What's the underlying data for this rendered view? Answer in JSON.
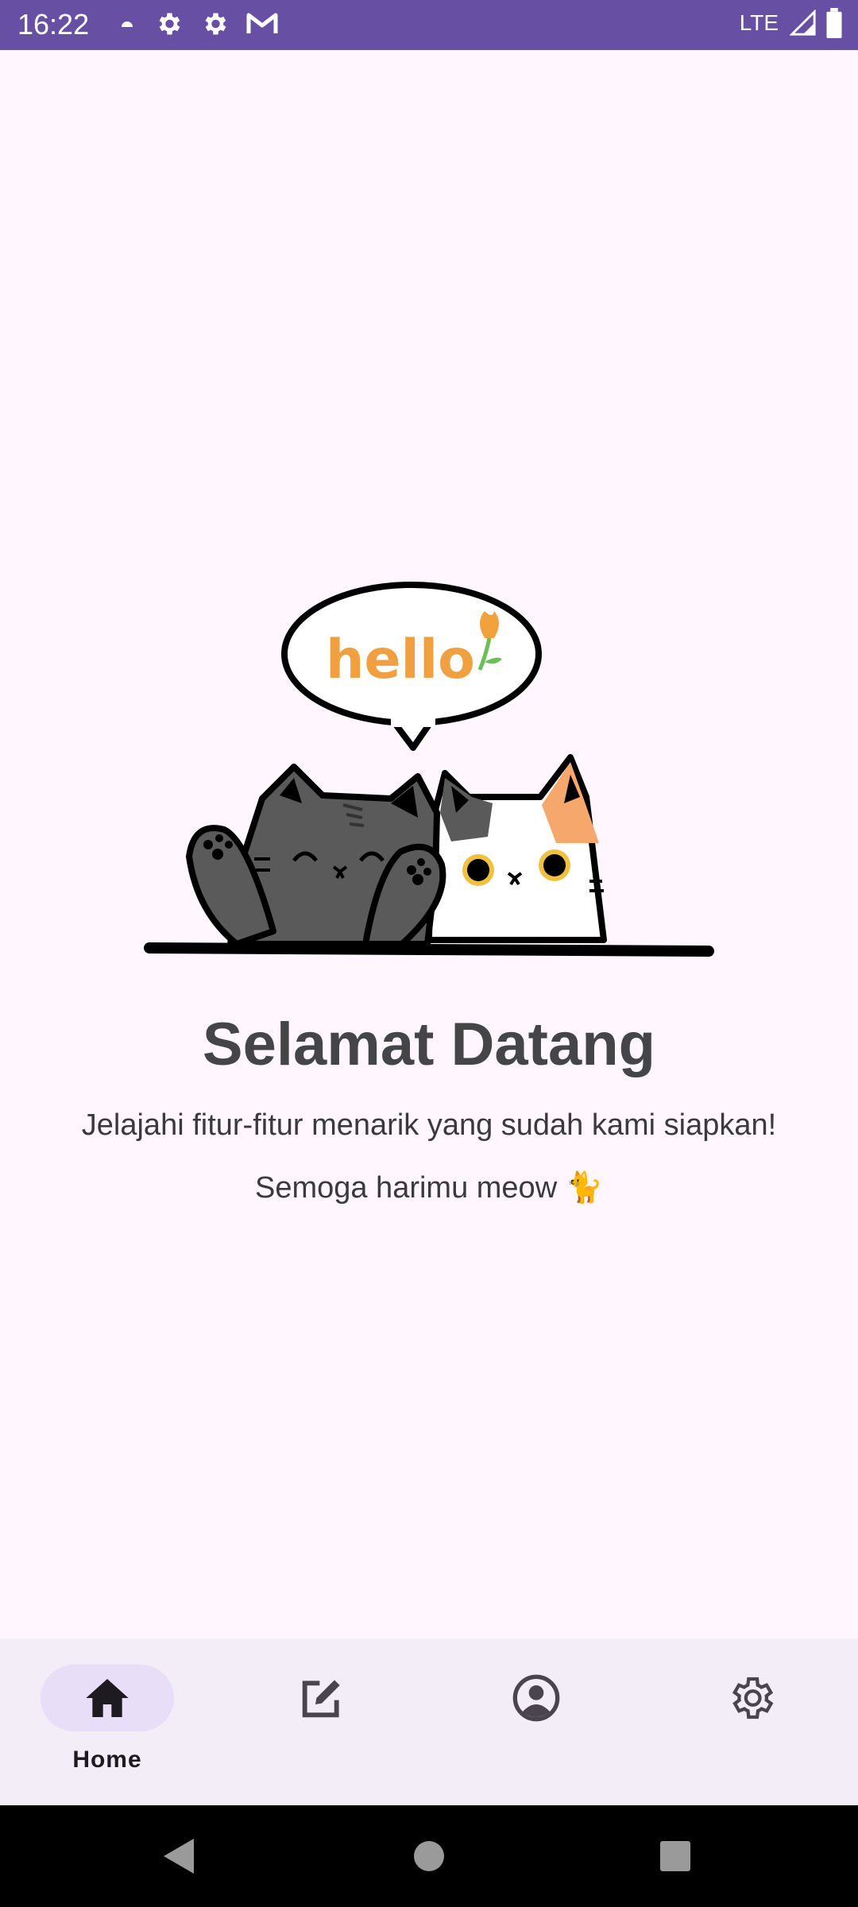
{
  "status_bar": {
    "time": "16:22",
    "network": "LTE",
    "left_icons": [
      "weather-icon",
      "gear-icon",
      "gear-icon",
      "gmail-icon"
    ],
    "right_icons": [
      "signal-icon",
      "battery-icon"
    ],
    "color": "#6750a4"
  },
  "hero": {
    "speech_bubble_text": "hello",
    "illustration": "two-cats-illustration"
  },
  "main": {
    "title": "Selamat Datang",
    "subtitle_line1": "Jelajahi fitur-fitur menarik yang sudah kami siapkan!",
    "subtitle_line2": "Semoga harimu meow 🐈"
  },
  "bottom_nav": {
    "items": [
      {
        "label": "Home",
        "icon": "home-icon",
        "active": true
      },
      {
        "label": "",
        "icon": "edit-icon",
        "active": false
      },
      {
        "label": "",
        "icon": "profile-icon",
        "active": false
      },
      {
        "label": "",
        "icon": "settings-icon",
        "active": false
      }
    ],
    "active_indicator_color": "#e8def8",
    "background_color": "#f3edf7"
  },
  "system_nav": {
    "buttons": [
      "back-icon",
      "home-circle-icon",
      "recents-icon"
    ]
  }
}
